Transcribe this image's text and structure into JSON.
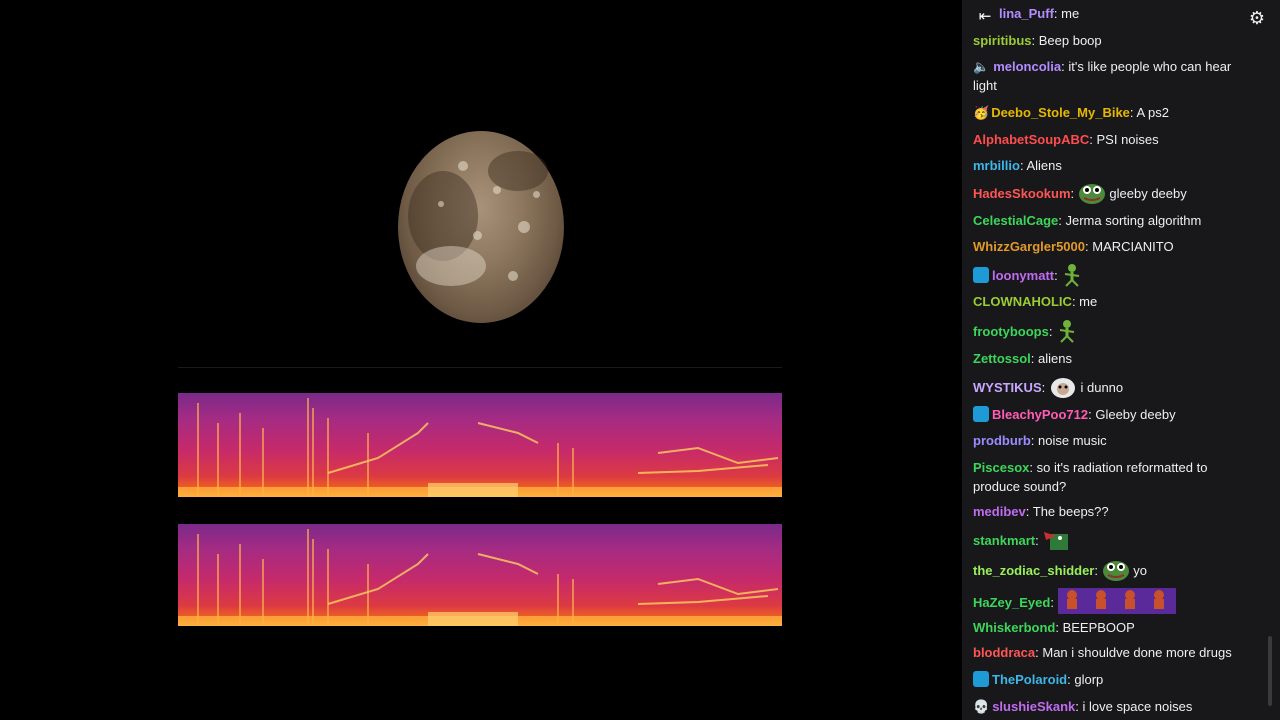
{
  "chat": {
    "messages": [
      {
        "user": "lina_Puff",
        "color": "#b38cff",
        "text": "me",
        "badge": ""
      },
      {
        "user": "spiritibus",
        "color": "#9acd32",
        "text": "Beep boop",
        "badge": ""
      },
      {
        "user": "meloncolia",
        "color": "#b38cff",
        "text": "it's like people who can hear light",
        "badge": "speaker"
      },
      {
        "user": "Deebo_Stole_My_Bike",
        "color": "#e6b800",
        "text": "A ps2",
        "badge": "emoji"
      },
      {
        "user": "AlphabetSoupABC",
        "color": "#ff4d4d",
        "text": "PSI noises",
        "badge": ""
      },
      {
        "user": "mrbillio",
        "color": "#3db6e8",
        "text": "Aliens",
        "badge": ""
      },
      {
        "user": "HadesSkookum",
        "color": "#ff5555",
        "text": "gleeby deeby",
        "badge": "",
        "emote": "pepe"
      },
      {
        "user": "CelestialCage",
        "color": "#3cd65a",
        "text": "Jerma sorting algorithm",
        "badge": ""
      },
      {
        "user": "WhizzGargler5000",
        "color": "#e09a2a",
        "text": "MARCIANITO",
        "badge": ""
      },
      {
        "user": "loonymatt",
        "color": "#c06cf0",
        "text": "",
        "badge": "prime",
        "emote": "alien"
      },
      {
        "user": "CLOWNAHOLIC",
        "color": "#9acd32",
        "text": "me",
        "badge": ""
      },
      {
        "user": "frootyboops",
        "color": "#3cd65a",
        "text": "",
        "badge": "",
        "emote": "alien"
      },
      {
        "user": "Zettossol",
        "color": "#3cd65a",
        "text": "aliens",
        "badge": ""
      },
      {
        "user": "WYSTIKUS",
        "color": "#c8a8ff",
        "text": "i dunno",
        "badge": "",
        "emote": "sheep"
      },
      {
        "user": "BleachyPoo712",
        "color": "#ff5cb5",
        "text": "Gleeby deeby",
        "badge": "prime"
      },
      {
        "user": "prodburb",
        "color": "#9b8cff",
        "text": "noise music",
        "badge": ""
      },
      {
        "user": "Piscesox",
        "color": "#3cd65a",
        "text": "so it's radiation reformatted to produce sound?",
        "badge": ""
      },
      {
        "user": "medibev",
        "color": "#c06cf0",
        "text": "The beeps??",
        "badge": ""
      },
      {
        "user": "stankmart",
        "color": "#3cd65a",
        "text": "",
        "badge": "",
        "emote": "croc"
      },
      {
        "user": "the_zodiac_shidder",
        "color": "#9af05a",
        "text": "yo",
        "badge": "",
        "emote": "pepe"
      },
      {
        "user": "HaZey_Eyed",
        "color": "#3cd65a",
        "text": "",
        "badge": "",
        "emote": "row4"
      },
      {
        "user": "Whiskerbond",
        "color": "#3cd65a",
        "text": "BEEPBOOP",
        "badge": ""
      },
      {
        "user": "bloddraca",
        "color": "#ff5555",
        "text": "Man i shouldve done more drugs",
        "badge": ""
      },
      {
        "user": "ThePolaroid",
        "color": "#3db6e8",
        "text": "glorp",
        "badge": "prime"
      },
      {
        "user": "slushieSkank",
        "color": "#c06cf0",
        "text": "i love space noises",
        "badge": "skull"
      }
    ]
  },
  "icons": {
    "back": "collapse-arrow-icon",
    "settings": "gear-icon"
  }
}
